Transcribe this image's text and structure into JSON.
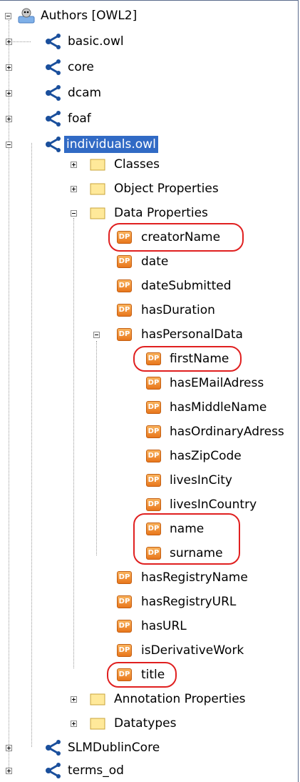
{
  "tree": {
    "root": "Authors [OWL2]",
    "ontologies_top": [
      "basic.owl",
      "core",
      "dcam",
      "foaf"
    ],
    "selected": "individuals.owl",
    "folders": {
      "classes": "Classes",
      "object_properties": "Object Properties",
      "data_properties": "Data Properties",
      "annotation_properties": "Annotation Properties",
      "datatypes": "Datatypes"
    },
    "dp_badge": "DP",
    "data_properties_a": [
      "creatorName",
      "date",
      "dateSubmitted",
      "hasDuration",
      "hasPersonalData"
    ],
    "personal_data": [
      "firstName",
      "hasEMailAdress",
      "hasMiddleName",
      "hasOrdinaryAdress",
      "hasZipCode",
      "livesInCity",
      "livesInCountry",
      "name",
      "surname"
    ],
    "data_properties_b": [
      "hasRegistryName",
      "hasRegistryURL",
      "hasURL",
      "isDerivativeWork",
      "title"
    ],
    "ontologies_bottom": [
      "SLMDublinCore",
      "terms_od"
    ]
  },
  "colors": {
    "selection": "#316ac5",
    "highlight_oval": "#e02020",
    "dp_icon": "#e8761c"
  }
}
